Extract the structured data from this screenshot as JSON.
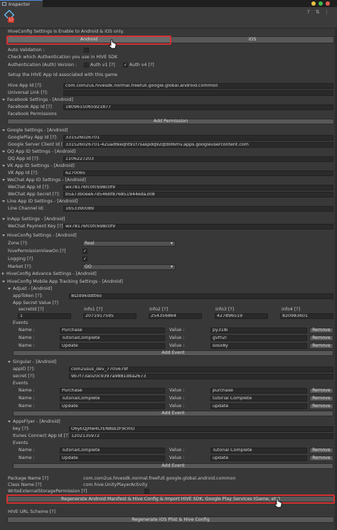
{
  "window": {
    "tab_title": "Inspector"
  },
  "header": {
    "badge": "{}"
  },
  "platform": {
    "notice": "HiveConfig Settings is Enable to Android & iOS only.",
    "android": "Android",
    "ios": "iOS",
    "auto_validation": "Auto Validation :",
    "check_auth": "Check which Authentication you use in HIVE SDK",
    "auth_version": "Authentication (Auth) Version :",
    "auth_v1": "Auth v1 [?]",
    "auth_v4": "Auth v4 [?]",
    "setup": "Setup the HIVE App Id associated with this game",
    "hive_app_id_label": "Hive App Id [?]:",
    "hive_app_id": "com.com2us.hivesdk.normal.freefull.google.global.android.common",
    "universal_link_label": "Universal Link [?]:",
    "universal_link": ""
  },
  "facebook": {
    "title": "Facebook Settings - [Android]",
    "app_id_label": "Facebook App Id [?]",
    "app_id": "1809615065921877",
    "permissions": "Facebook Permissions",
    "add_permission": "Add Permission"
  },
  "google": {
    "title": "Google Settings - [Android]",
    "play_app_id_label": "GooglePlay App Id [?]:",
    "play_app_id": "331526026701",
    "client_id_label": "Google Server Client Id [?]:",
    "client_id": "331526026701-42uadtkeqht91f7saspdq92qtdlll6mv.apps.googleusercontent.com"
  },
  "qq": {
    "title": "QQ App ID Settings - [Android]",
    "label": "QQ App Id [?]:",
    "value": "1106227203"
  },
  "vk": {
    "title": "VK App ID Settings - [Android]",
    "label": "VK App Id [?]:",
    "value": "6270065"
  },
  "wechat": {
    "title": "WeChat App ID Settings - [Android]",
    "id_label": "WeChat App Id [?]:",
    "id": "wx78176fc0fc698c0f9",
    "secret_label": "WeChat App Secret [?]:",
    "secret": "b5a73b0ee67d546bf876851944eda308"
  },
  "line": {
    "title": "Line App ID Settings - [Android]",
    "label": "Line Channel Id:",
    "value": "1653390089"
  },
  "inapp": {
    "title": "InApp Settings - [Android]",
    "label": "WeChat Payment Key [?]:",
    "value": "wx78176fc0fc698c0f9"
  },
  "hiveconfig": {
    "title": "HiveConfig Settings - [Android]",
    "zone_label": "Zone [?]:",
    "zone": "Real",
    "perm_label": "hivePermissionViewOn [?]",
    "logging_label": "Logging [?]",
    "market_label": "Market [?]:",
    "market": "GO",
    "advance_title": "HiveConfig Advance Settings - [Android]",
    "tracking_title": "HiveConfig Mobile App Tracking Settings - [Android]"
  },
  "adjust": {
    "title": "Adjust - [Android]",
    "token_label": "appToken [?]:",
    "token": "8szd9kddtt6o",
    "secret_label": "App Secret Value [?]",
    "col_labels": [
      "secretId [?]",
      "info1 [?]",
      "info2 [?]",
      "info3 [?]",
      "info4 [?]"
    ],
    "col_values": [
      "1",
      "2071917595",
      "254356864",
      "427896519",
      "820983601"
    ],
    "events_label": "Events",
    "events": [
      {
        "name": "Purchase",
        "value": "py318i"
      },
      {
        "name": "TutorialComplete",
        "value": "gvfh2l"
      },
      {
        "name": "Update",
        "value": "sosx8y"
      }
    ]
  },
  "singular": {
    "title": "Singular - [Android]",
    "appid_label": "appID [?]:",
    "appid": "com2usus_dev_7705679f",
    "secret_label": "secret [?]:",
    "secret": "9b7f73a020c9397a9881dba2673",
    "events_label": "Events",
    "events": [
      {
        "name": "Purchase",
        "value": "purchase"
      },
      {
        "name": "TutorialComplete",
        "value": "tutorial Complete"
      },
      {
        "name": "Update",
        "value": "update"
      }
    ]
  },
  "appsflyer": {
    "title": "AppsFlyer - [Android]",
    "key_label": "key [?]:",
    "key": "O6yEQjHw4CrEN8sEzF9cmU",
    "itunes_label": "Itunes Connect App Id [?]:",
    "itunes": "1202135972",
    "events_label": "Events",
    "events": [
      {
        "name": "TutorialComplete",
        "value": "Tutorial Complete"
      },
      {
        "name": "Update",
        "value": "update"
      }
    ]
  },
  "common": {
    "name_label": "Name :",
    "value_label": "Value :",
    "remove": "Remove",
    "add_event": "Add Event"
  },
  "footer": {
    "package_label": "Package Name [?]",
    "package": "com.com2us.hivesdk.normal.freefull.google.global.android.common",
    "class_label": "Class Name [?]",
    "class": "com.hive.UnityPlayerActivity",
    "write_perm_label": "WriteExternalStoragePermission [?]",
    "regen_android": "Regenerate Android Manifest & Hive Config & Import HIVE SDK, Google Play Services (Game, etc)",
    "url_scheme": "HIVE URL Scheme [?]",
    "regen_ios": "Regenerate iOS Plist & Hive Config"
  },
  "colors": {
    "highlight": "#d63232",
    "accent": "#4d8bd8"
  }
}
